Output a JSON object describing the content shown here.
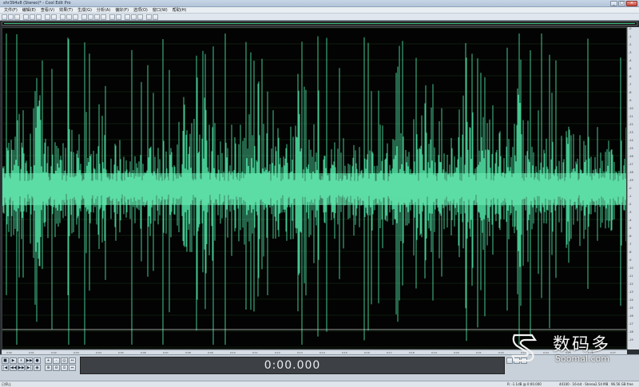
{
  "window": {
    "title": "shr394v8 (Stereo)* - Cool Edit Pro",
    "minimize_icon": "minimize-icon",
    "maximize_icon": "maximize-icon",
    "close_label": "×"
  },
  "menu": [
    "文件(F)",
    "编辑(E)",
    "查看(V)",
    "效果(T)",
    "生成(G)",
    "分析(A)",
    "偏好(F)",
    "选项(O)",
    "窗口(W)",
    "帮助(H)"
  ],
  "transport": {
    "row1": [
      "■",
      "▶",
      "⏸",
      "▶▶",
      "●"
    ],
    "row2": [
      "|◀",
      "◀◀",
      "▶▶",
      "▶|",
      "◉"
    ],
    "zoom_row1": [
      "+",
      "-",
      "◎",
      "↔"
    ],
    "zoom_row2": [
      "⊕",
      "⊖",
      "⊙",
      "⇔"
    ]
  },
  "time_display": "0:00.000",
  "status": {
    "left": "已停止",
    "sample": "R: -1.1dB @ 0:00.000",
    "format": "44100 · 16-bit · Stereo",
    "size": "2.54 MB",
    "free": "96.56 GB free"
  },
  "watermark": {
    "cn": "数码多",
    "en": "Soomal.com",
    "logo_icon": "soomal-logo-icon"
  },
  "colors": {
    "waveform": "#4fdca0",
    "waveform_center": "#6ff0b8",
    "background": "#020302",
    "grid": "#1f3a1f"
  }
}
